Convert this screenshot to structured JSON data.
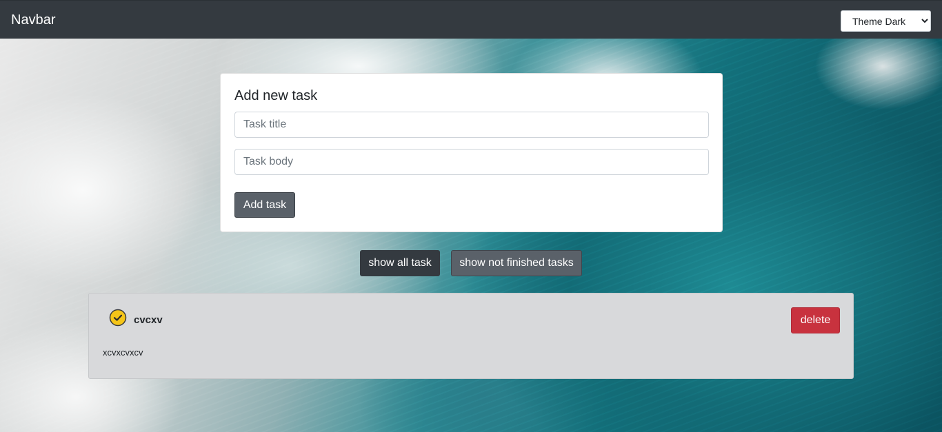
{
  "navbar": {
    "brand": "Navbar",
    "theme_select": {
      "selected": "Theme Dark",
      "options": [
        "Theme Dark"
      ]
    }
  },
  "add_task_form": {
    "title": "Add new task",
    "title_input": {
      "value": "",
      "placeholder": "Task title"
    },
    "body_input": {
      "value": "",
      "placeholder": "Task body"
    },
    "submit_label": "Add task"
  },
  "filters": {
    "show_all_label": "show all task",
    "show_not_finished_label": "show not finished tasks"
  },
  "tasks": [
    {
      "title": "cvcxv",
      "body": "xcvxcvxcv",
      "finished": true,
      "status_icon": "check-circle-icon",
      "delete_label": "delete"
    }
  ],
  "colors": {
    "navbar_bg": "#343a40",
    "check_icon": "#f5c518",
    "delete_button": "#c8323e",
    "task_card_bg": "#d8d9db"
  }
}
